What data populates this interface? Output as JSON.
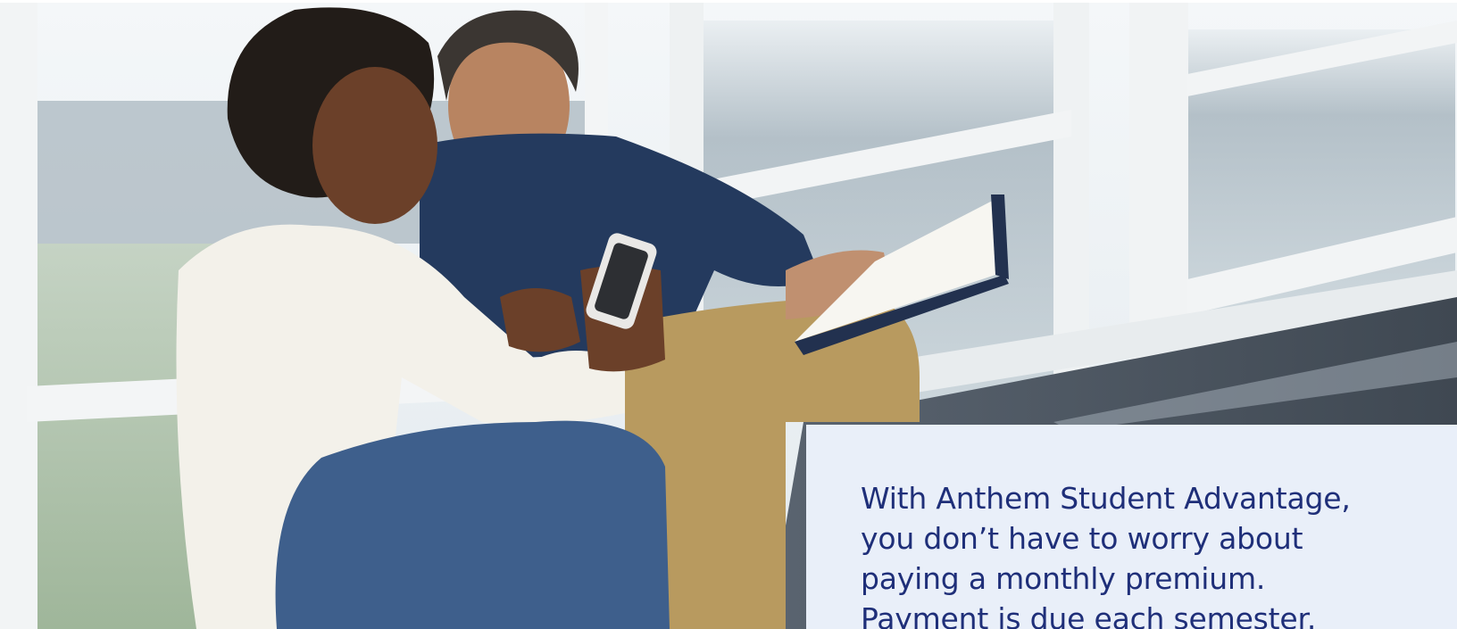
{
  "hero": {
    "image": "students-with-phone-and-book-photo"
  },
  "promo": {
    "text": "With Anthem Student Advantage, you don’t have to worry about paying a monthly premium. Payment is due each semester."
  },
  "colors": {
    "card_background": "#e9eff9",
    "text_primary": "#1f2f79"
  }
}
